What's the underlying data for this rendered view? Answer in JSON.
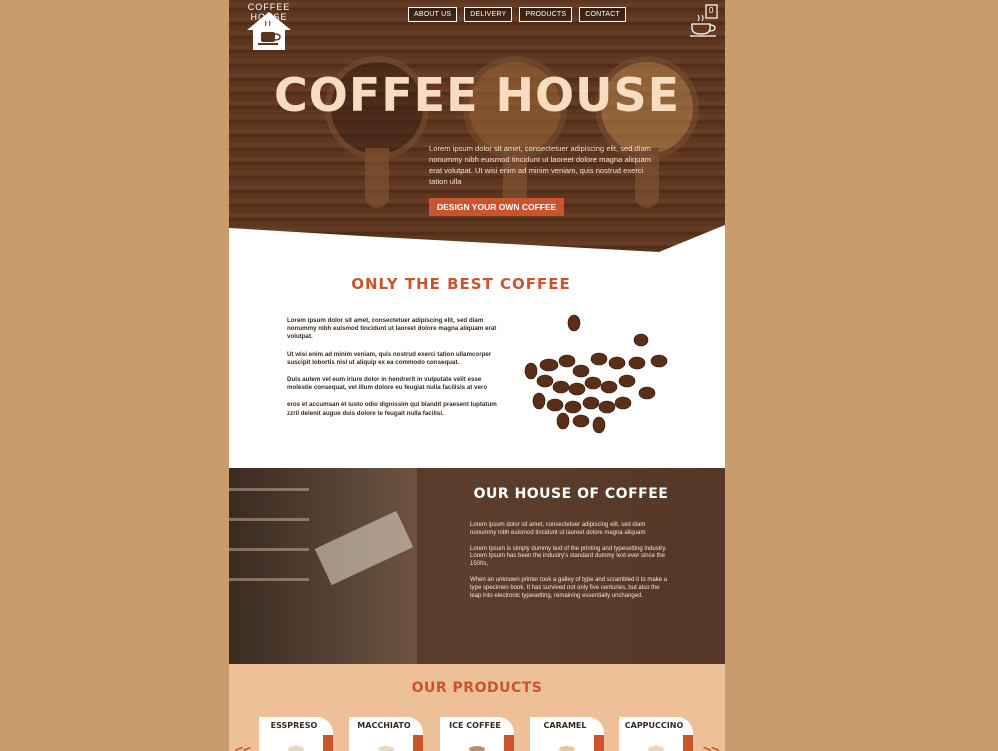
{
  "brand": {
    "logo_text": "COFFEE HOUSE"
  },
  "nav": [
    "ABOUT US",
    "DELIVERY",
    "PRODUCTS",
    "CONTACT"
  ],
  "cart": {
    "count": "0"
  },
  "hero": {
    "title": "COFFEE HOUSE",
    "text": "Lorem ipsum dolor sit amet, consectetuer adipiscing elit, sed diam nonummy nibh euismod tincidunt ut laoreet dolore magna aliquam erat volutpat. Ut wisi enim ad minim veniam, quis nostrud exerci tation ulla",
    "cta": "DESIGN YOUR OWN COFFEE"
  },
  "best": {
    "title": "ONLY THE BEST COFFEE",
    "paragraphs": [
      "Lorem ipsum dolor sit amet, consectetuer adipiscing elit, sed diam nonummy nibh euismod tincidunt ut laoreet dolore magna aliquam erat volutpat.",
      "Ut wisi enim ad minim veniam, quis nostrud exerci tation ullamcorper suscipit lobortis nisl ut aliquip ex ea commodo consequat.",
      "Duis autem vel eum iriure dolor in hendrerit in vulputate velit esse molestie consequat, vel illum dolore eu feugiat nulla facilisis at vero",
      "eros et accumsan et iusto odio dignissim qui blandit praesent luptatum zzril delenit augue duis dolore te feugait nulla facilisi."
    ]
  },
  "house": {
    "title": "OUR HOUSE OF COFFEE",
    "paragraphs": [
      "Lorem ipsum dolor sit amet, consectetuer adipiscing elit, sed diam nonummy nibh euismod tincidunt ut laoreet dolore magna aliquam",
      "Lorem Ipsum is simply dummy text of the printing and typesetting industry. Lorem Ipsum has been the industry's standard dummy text ever since the 1500s,",
      "When an unknown printer took a galley of type and scrambled it to make a type specimen book. It has survived not only five centuries, but also the leap into electronic typesetting, remaining essentially unchanged."
    ]
  },
  "products": {
    "title": "OUR PRODUCTS",
    "items": [
      "ESSPRESO",
      "MACCHIATO",
      "ICE COFFEE",
      "CARAMEL",
      "CAPPUCCINO"
    ],
    "prev": "<<",
    "next": ">>"
  }
}
